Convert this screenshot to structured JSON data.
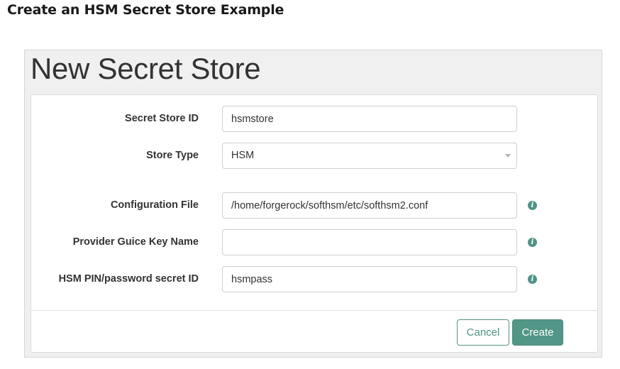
{
  "doc_heading": "Create an HSM Secret Store Example",
  "page_title": "New Secret Store",
  "form": {
    "secret_store_id": {
      "label": "Secret Store ID",
      "value": "hsmstore"
    },
    "store_type": {
      "label": "Store Type",
      "value": "HSM"
    },
    "configuration_file": {
      "label": "Configuration File",
      "value": "/home/forgerock/softhsm/etc/softhsm2.conf"
    },
    "provider_guice_key_name": {
      "label": "Provider Guice Key Name",
      "value": "",
      "placeholder": ""
    },
    "hsm_pin_secret_id": {
      "label": "HSM PIN/password secret ID",
      "value": "hsmpass"
    }
  },
  "info_icon_glyph": "i",
  "buttons": {
    "cancel": "Cancel",
    "create": "Create"
  },
  "colors": {
    "accent": "#519686",
    "info_icon": "#4f9486"
  }
}
